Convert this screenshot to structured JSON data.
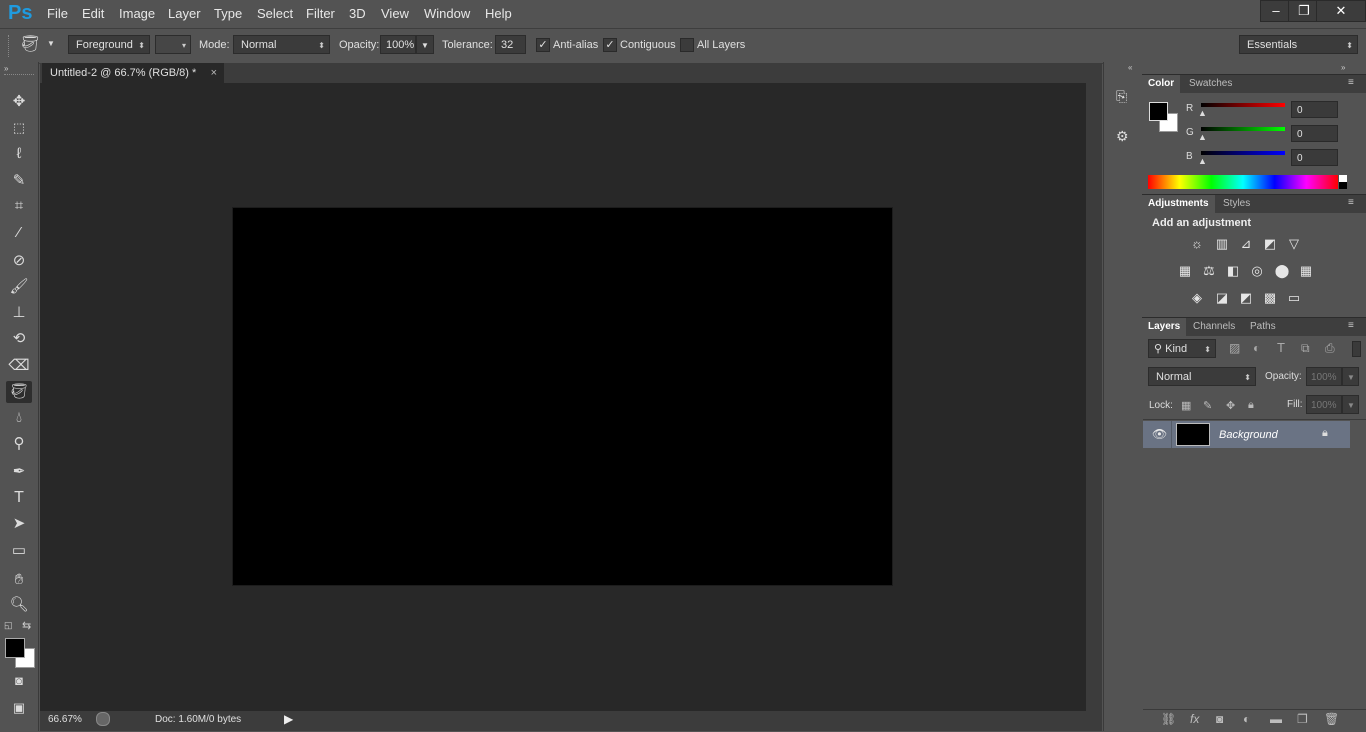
{
  "app": {
    "logo": "Ps",
    "menu": [
      "File",
      "Edit",
      "Image",
      "Layer",
      "Type",
      "Select",
      "Filter",
      "3D",
      "View",
      "Window",
      "Help"
    ],
    "window_controls": [
      "–",
      "❐",
      "✕"
    ]
  },
  "options": {
    "fill_source": "Foreground",
    "mode_label": "Mode:",
    "mode_value": "Normal",
    "opacity_label": "Opacity:",
    "opacity_value": "100%",
    "tolerance_label": "Tolerance:",
    "tolerance_value": "32",
    "antialias_label": "Anti-alias",
    "antialias_checked": true,
    "contiguous_label": "Contiguous",
    "contiguous_checked": true,
    "all_layers_label": "All Layers",
    "all_layers_checked": false,
    "workspace": "Essentials"
  },
  "document": {
    "tab_title": "Untitled-2 @ 66.7% (RGB/8) *",
    "tab_close": "×",
    "canvas_color": "#000000"
  },
  "status": {
    "zoom": "66.67%",
    "doc_info": "Doc: 1.60M/0 bytes"
  },
  "color_panel": {
    "tabs": [
      "Color",
      "Swatches"
    ],
    "channels": [
      {
        "label": "R",
        "value": "0",
        "color": "#e01010"
      },
      {
        "label": "G",
        "value": "0",
        "color": "#10c010"
      },
      {
        "label": "B",
        "value": "0",
        "color": "#1010e0"
      }
    ]
  },
  "adjustments_panel": {
    "tabs": [
      "Adjustments",
      "Styles"
    ],
    "heading": "Add an adjustment",
    "icons": [
      [
        "☼",
        "▥",
        "⊿",
        "◩",
        "▽"
      ],
      [
        "▦",
        "⚖",
        "◧",
        "◎",
        "⬤",
        "▦"
      ],
      [
        "◈",
        "◪",
        "◩",
        "▩",
        "▭"
      ]
    ]
  },
  "layers_panel": {
    "tabs": [
      "Layers",
      "Channels",
      "Paths"
    ],
    "filter_kind": "Kind",
    "blend_mode": "Normal",
    "opacity_label": "Opacity:",
    "opacity_value": "100%",
    "lock_label": "Lock:",
    "fill_label": "Fill:",
    "fill_value": "100%",
    "layers": [
      {
        "name": "Background",
        "visible": true,
        "locked": true
      }
    ]
  }
}
